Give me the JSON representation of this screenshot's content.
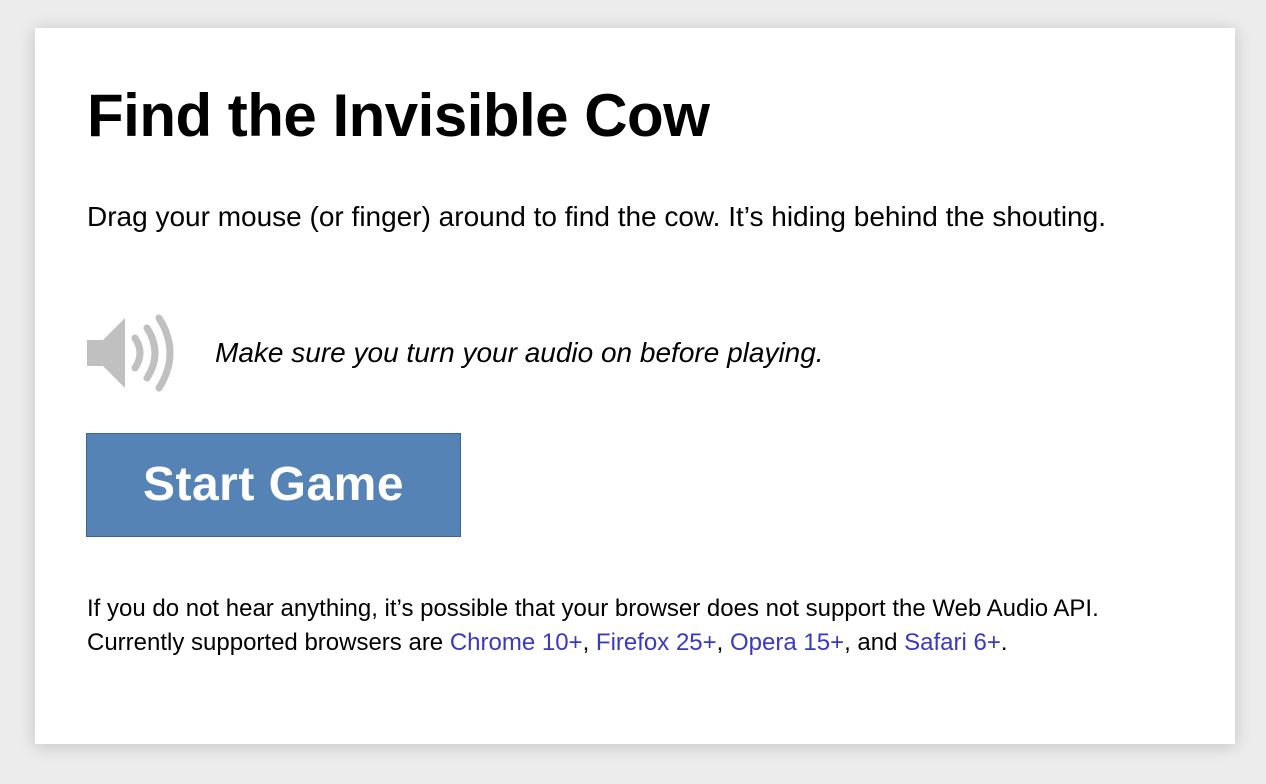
{
  "page": {
    "title": "Find the Invisible Cow",
    "intro": "Drag your mouse (or finger) around to find the cow. It’s hiding behind the shouting.",
    "audio": {
      "icon": "speaker-volume-icon",
      "note": "Make sure you turn your audio on before playing."
    },
    "start_button": {
      "label": "Start Game"
    },
    "footnote": {
      "text_before": "If you do not hear anything, it’s possible that your browser does not support the Web Audio API. Currently supported browsers are ",
      "links": [
        {
          "label": "Chrome 10+"
        },
        {
          "label": "Firefox 25+"
        },
        {
          "label": "Opera 15+"
        },
        {
          "label": "Safari 6+"
        }
      ],
      "sep1": ", ",
      "sep2": ", ",
      "sep3": ", and ",
      "text_after": "."
    }
  },
  "colors": {
    "background": "#ececec",
    "card": "#ffffff",
    "button": "#5583b5",
    "link": "#3a3ac0",
    "icon": "#c0c0c0"
  }
}
